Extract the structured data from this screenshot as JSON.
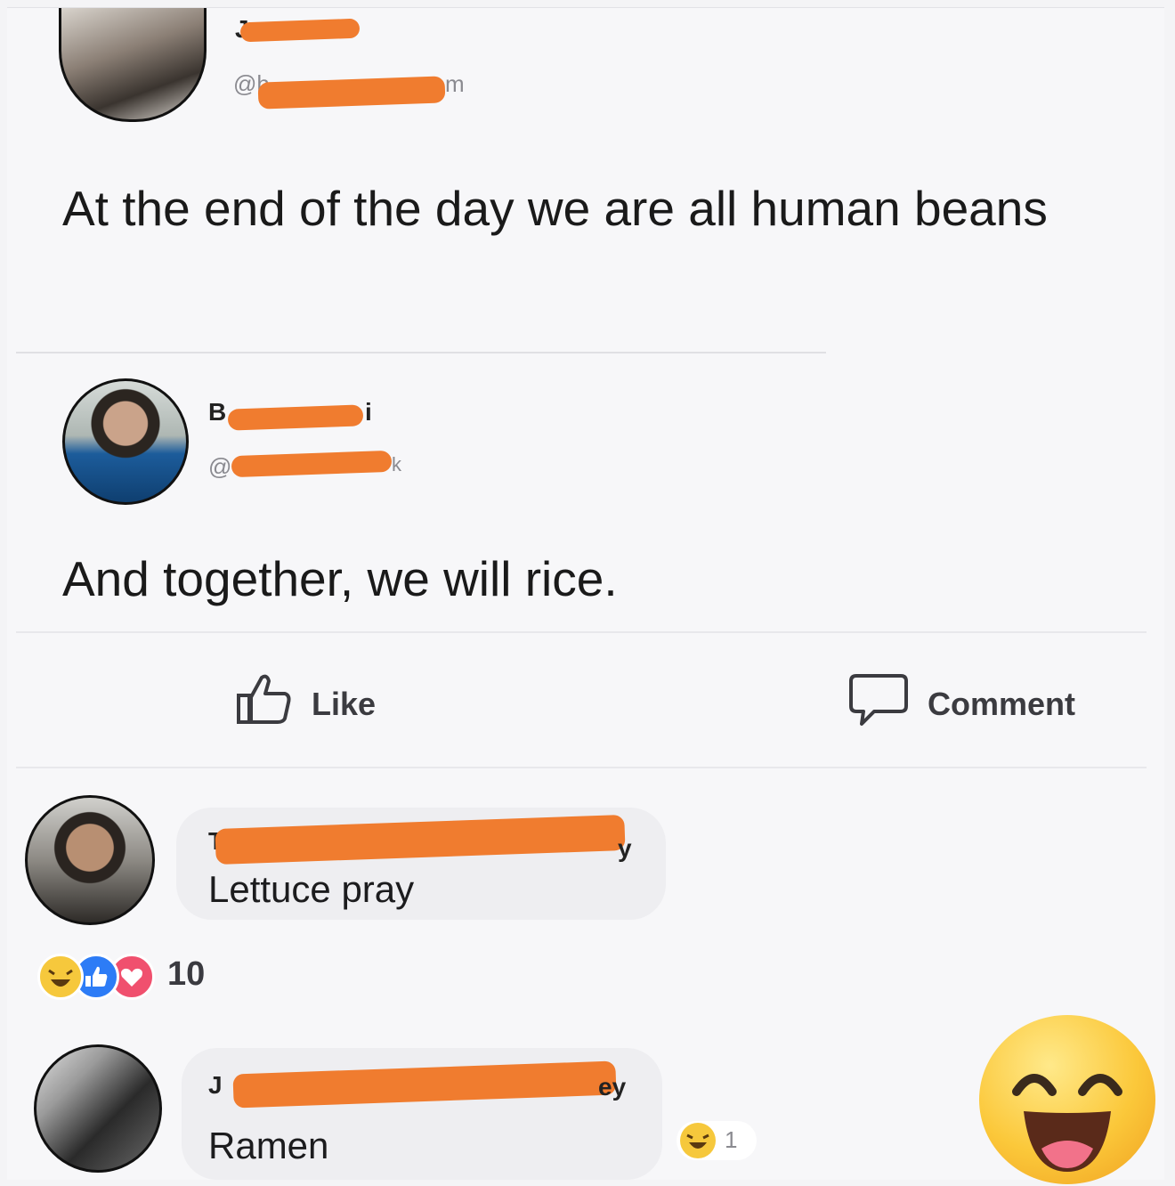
{
  "post": {
    "author_fragment": "J",
    "handle_fragment": "@h",
    "handle_tail": "m",
    "text": "At the end of the day we are all human beans"
  },
  "reply": {
    "author_fragment": "B",
    "author_tail": "i",
    "handle_fragment": "@",
    "handle_tail": "k",
    "text": "And together, we will rice."
  },
  "actions": {
    "like_label": "Like",
    "comment_label": "Comment"
  },
  "comments": [
    {
      "author_fragment": "T",
      "author_tail": "y",
      "text": "Lettuce pray",
      "reactions": [
        "haha-icon",
        "like-icon",
        "love-icon"
      ],
      "reaction_count": "10"
    },
    {
      "author_fragment": "J",
      "author_tail": "ey",
      "text": "Ramen",
      "reactions": [
        "haha-icon"
      ],
      "reaction_count": "1"
    }
  ],
  "colors": {
    "redaction": "#f07c2f",
    "like_blue": "#2d7cf6",
    "love_red": "#f0506e",
    "haha_yellow": "#f6c83c"
  }
}
